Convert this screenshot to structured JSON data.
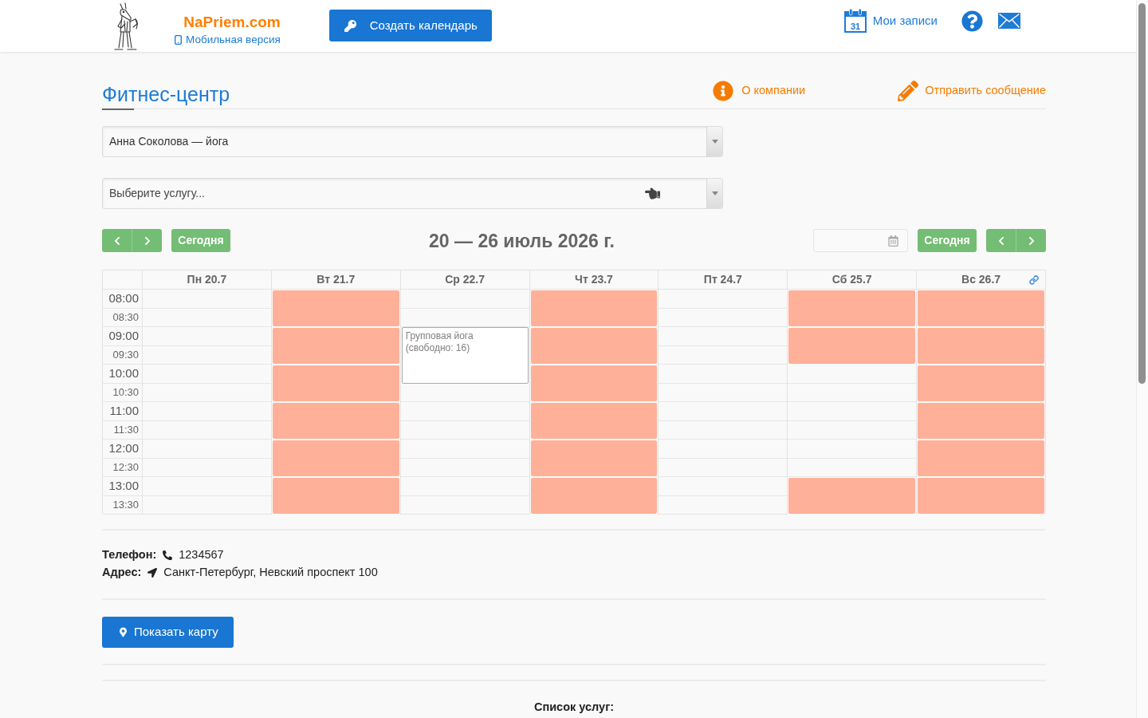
{
  "header": {
    "brand": "NaPriem.com",
    "mobile_link": "Мобильная версия",
    "create_button": "Создать календарь",
    "my_bookings": {
      "icon_day": "31",
      "label": "Мои записи"
    }
  },
  "company": {
    "title": "Фитнес-центр",
    "links": [
      {
        "kind": "info",
        "label": "О компании"
      },
      {
        "kind": "message",
        "label": "Отправить сообщение"
      }
    ]
  },
  "selects": [
    {
      "value": "Анна Соколова — йога"
    },
    {
      "placeholder": "Выберите услугу..."
    }
  ],
  "calendar": {
    "today_left": "Сегодня",
    "range_title": "20 — 26 июль 2026 г.",
    "today_right": "Сегодня",
    "times": [
      {
        "label": "08:00",
        "kind": "hour"
      },
      {
        "label": "08:30",
        "kind": "half_hour"
      },
      {
        "label": "09:00",
        "kind": "hour"
      },
      {
        "label": "09:30",
        "kind": "half_hour"
      },
      {
        "label": "10:00",
        "kind": "hour"
      },
      {
        "label": "10:30",
        "kind": "half_hour"
      },
      {
        "label": "11:00",
        "kind": "hour"
      },
      {
        "label": "11:30",
        "kind": "half_hour"
      },
      {
        "label": "12:00",
        "kind": "hour"
      },
      {
        "label": "12:30",
        "kind": "half_hour"
      },
      {
        "label": "13:00",
        "kind": "hour"
      },
      {
        "label": "13:30",
        "kind": "half_hour"
      }
    ],
    "days": [
      {
        "label": "Пн 20.7",
        "slots": [
          {
            "kind": "free"
          },
          {
            "kind": "free"
          },
          {
            "kind": "free"
          },
          {
            "kind": "free"
          },
          {
            "kind": "free"
          },
          {
            "kind": "free"
          },
          {
            "kind": "free"
          },
          {
            "kind": "free"
          },
          {
            "kind": "free"
          },
          {
            "kind": "free"
          },
          {
            "kind": "free"
          },
          {
            "kind": "free"
          }
        ]
      },
      {
        "label": "Вт 21.7",
        "slots": [
          {
            "kind": "booked"
          },
          {
            "kind": "booked"
          },
          {
            "kind": "booked"
          },
          {
            "kind": "booked"
          },
          {
            "kind": "booked"
          },
          {
            "kind": "booked"
          },
          {
            "kind": "booked"
          },
          {
            "kind": "booked"
          },
          {
            "kind": "booked"
          },
          {
            "kind": "booked"
          },
          {
            "kind": "booked"
          },
          {
            "kind": "booked"
          }
        ]
      },
      {
        "label": "Ср 22.7",
        "slots": [
          {
            "kind": "free"
          },
          {
            "kind": "free"
          },
          {
            "kind": "event",
            "lines": [
              "Групповая йога",
              "(свободно: 16)"
            ]
          },
          {
            "kind": "event"
          },
          {
            "kind": "event"
          },
          {
            "kind": "free"
          },
          {
            "kind": "free"
          },
          {
            "kind": "free"
          },
          {
            "kind": "free"
          },
          {
            "kind": "free"
          },
          {
            "kind": "free"
          },
          {
            "kind": "free"
          }
        ]
      },
      {
        "label": "Чт 23.7",
        "slots": [
          {
            "kind": "booked"
          },
          {
            "kind": "booked"
          },
          {
            "kind": "booked"
          },
          {
            "kind": "booked"
          },
          {
            "kind": "booked"
          },
          {
            "kind": "booked"
          },
          {
            "kind": "booked"
          },
          {
            "kind": "booked"
          },
          {
            "kind": "booked"
          },
          {
            "kind": "booked"
          },
          {
            "kind": "booked"
          },
          {
            "kind": "booked"
          }
        ]
      },
      {
        "label": "Пт 24.7",
        "slots": [
          {
            "kind": "free"
          },
          {
            "kind": "free"
          },
          {
            "kind": "free"
          },
          {
            "kind": "free"
          },
          {
            "kind": "free"
          },
          {
            "kind": "free"
          },
          {
            "kind": "free"
          },
          {
            "kind": "free"
          },
          {
            "kind": "free"
          },
          {
            "kind": "free"
          },
          {
            "kind": "free"
          },
          {
            "kind": "free"
          }
        ]
      },
      {
        "label": "Сб 25.7",
        "slots": [
          {
            "kind": "booked"
          },
          {
            "kind": "booked"
          },
          {
            "kind": "booked"
          },
          {
            "kind": "booked"
          },
          {
            "kind": "free"
          },
          {
            "kind": "free"
          },
          {
            "kind": "free"
          },
          {
            "kind": "free"
          },
          {
            "kind": "free"
          },
          {
            "kind": "free"
          },
          {
            "kind": "booked"
          },
          {
            "kind": "booked"
          }
        ]
      },
      {
        "label": "Вс 26.7",
        "slots": [
          {
            "kind": "booked"
          },
          {
            "kind": "booked"
          },
          {
            "kind": "booked"
          },
          {
            "kind": "booked"
          },
          {
            "kind": "booked"
          },
          {
            "kind": "booked"
          },
          {
            "kind": "booked"
          },
          {
            "kind": "booked"
          },
          {
            "kind": "booked"
          },
          {
            "kind": "booked"
          },
          {
            "kind": "booked"
          },
          {
            "kind": "booked"
          }
        ]
      }
    ]
  },
  "contacts": [
    {
      "kind": "phone",
      "label": "Телефон:",
      "value": "1234567"
    },
    {
      "kind": "address",
      "label": "Адрес:",
      "value": "Санкт-Петербург, Невский проспект 100"
    }
  ],
  "map_button": "Показать карту",
  "services_heading": "Список услуг:"
}
